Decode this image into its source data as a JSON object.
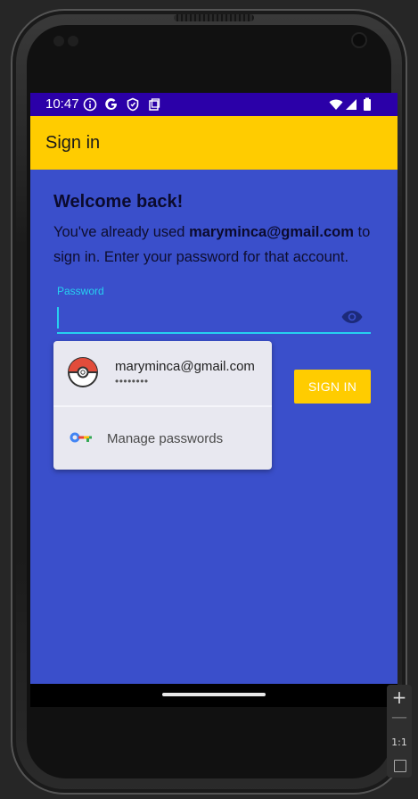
{
  "status_bar": {
    "time": "10:47",
    "icons": [
      "info-icon",
      "google-icon",
      "vpn-shield-icon",
      "clipboard-icon",
      "wifi-icon",
      "signal-icon",
      "battery-icon"
    ]
  },
  "app_bar": {
    "title": "Sign in"
  },
  "content": {
    "welcome": "Welcome back!",
    "message_prefix": "You've already used ",
    "message_email": "maryminca@gmail.com",
    "message_suffix": " to sign in. Enter your password for that account."
  },
  "password_field": {
    "label": "Password",
    "value": ""
  },
  "sign_in_button": {
    "label": "SIGN IN"
  },
  "autofill": {
    "account_email": "maryminca@gmail.com",
    "account_masked_password": "••••••••",
    "manage_label": "Manage passwords"
  },
  "emulator_controls": {
    "zoom_in": "+",
    "zoom_out": "—",
    "actual_size": "1:1"
  },
  "colors": {
    "status_bar": "#2b00a8",
    "app_bar": "#ffcc00",
    "background": "#3a4fcb",
    "accent": "#26d0f0",
    "button": "#ffcc00"
  }
}
